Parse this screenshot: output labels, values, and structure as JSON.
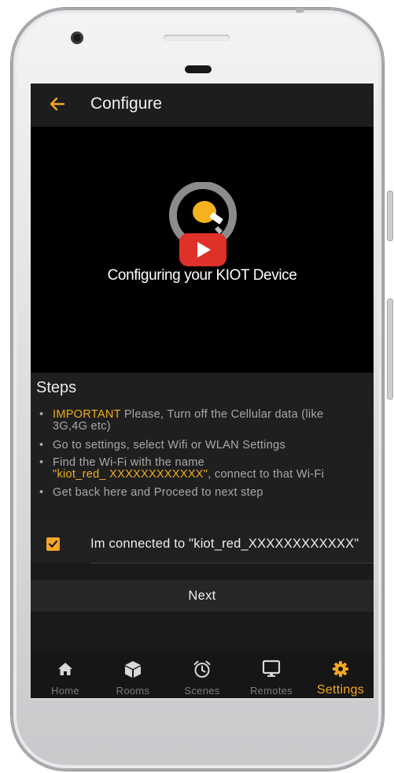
{
  "app_bar": {
    "title": "Configure",
    "back_icon": "arrow-left-icon"
  },
  "video": {
    "title": "Configuring your KIOT Device",
    "play_icon": "youtube-play-icon"
  },
  "steps": {
    "heading": "Steps",
    "items": [
      {
        "highlight": "IMPORTANT",
        "line1": " Please, Turn off the Cellular data (like",
        "line2": "3G,4G etc)"
      },
      {
        "text": "Go to settings, select Wifi or WLAN Settings"
      },
      {
        "line1": "Find the Wi-Fi with the name",
        "highlight": "\"kiot_red_ XXXXXXXXXXXX\"",
        "line2_rest": ", connect to that Wi-Fi"
      },
      {
        "text": "Get back here and Proceed to next step"
      }
    ]
  },
  "checkbox": {
    "label": "Im connected to \"kiot_red_XXXXXXXXXXXX\"",
    "checked": true
  },
  "next_button": {
    "label": "Next"
  },
  "bottom_nav": {
    "items": [
      {
        "label": "Home",
        "icon": "home-icon",
        "active": false
      },
      {
        "label": "Rooms",
        "icon": "cube-icon",
        "active": false
      },
      {
        "label": "Scenes",
        "icon": "alarm-clock-icon",
        "active": false
      },
      {
        "label": "Remotes",
        "icon": "monitor-icon",
        "active": false
      },
      {
        "label": "Settings",
        "icon": "gear-icon",
        "active": true
      }
    ]
  },
  "colors": {
    "accent": "#f5a623",
    "highlight_text": "#f0ad1e",
    "youtube_red": "#e0302a"
  }
}
